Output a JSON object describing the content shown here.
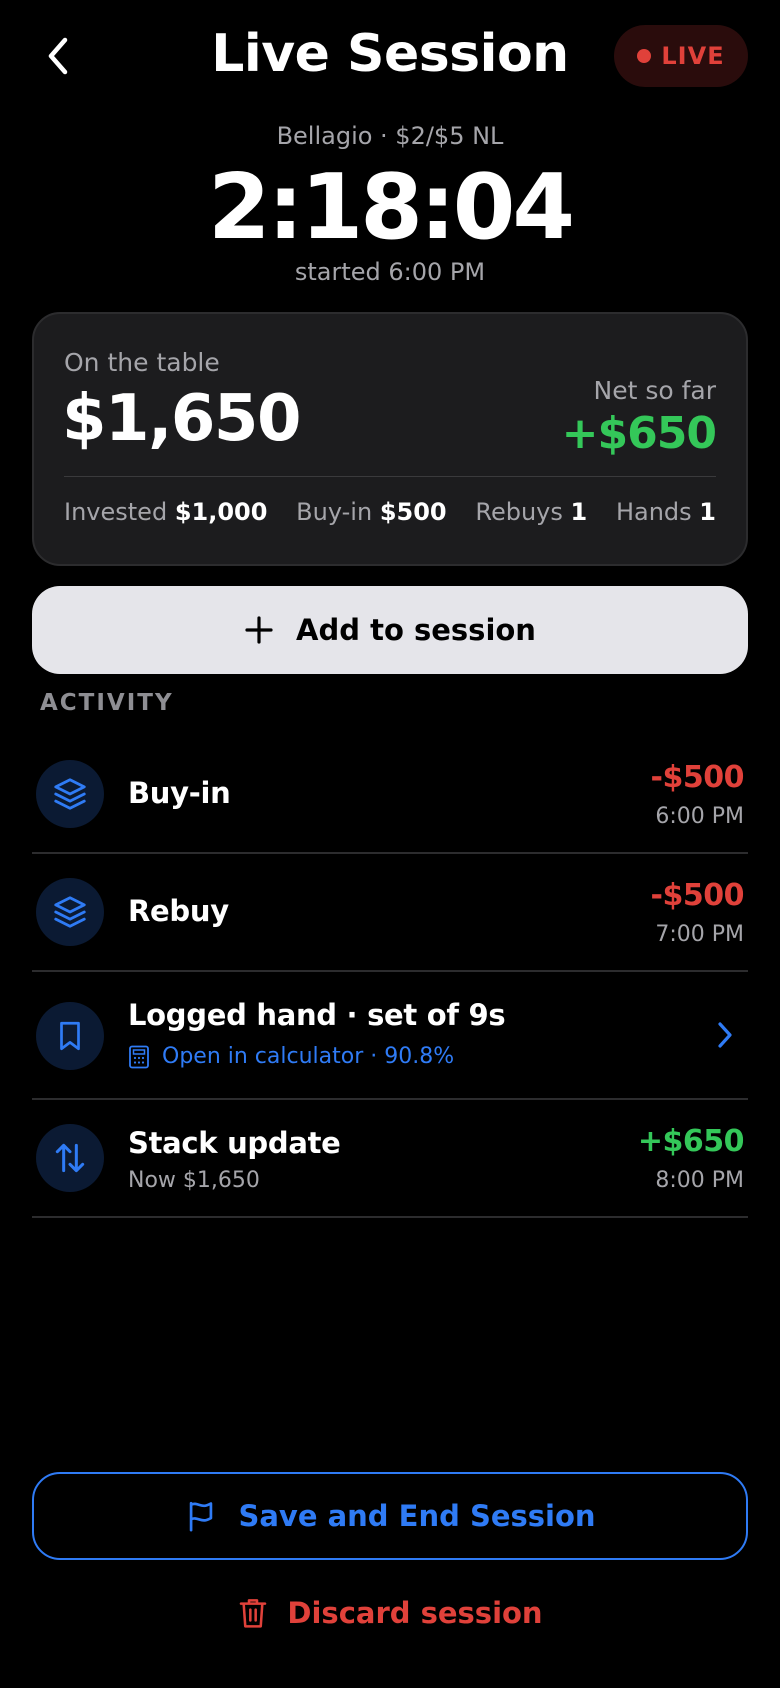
{
  "header": {
    "title": "Live Session",
    "live_label": "LIVE",
    "back_icon": "chevron-left-icon"
  },
  "session": {
    "venue": "Bellagio · $2/$5 NL",
    "timer": "2:18:04",
    "started": "started 6:00 PM"
  },
  "summary": {
    "on_table_label": "On the table",
    "on_table_value": "$1,650",
    "net_label": "Net so far",
    "net_value": "+$650",
    "stats": [
      {
        "label": "Invested",
        "value": "$1,000"
      },
      {
        "label": "Buy-in",
        "value": "$500"
      },
      {
        "label": "Rebuys",
        "value": "1"
      },
      {
        "label": "Hands",
        "value": "1"
      }
    ]
  },
  "add_button": {
    "label": "Add to session",
    "icon": "plus-icon"
  },
  "activity": {
    "heading": "ACTIVITY",
    "items": [
      {
        "title": "Buy-in",
        "amount": "-$500",
        "time": "6:00 PM",
        "icon": "layers-icon"
      },
      {
        "title": "Rebuy",
        "amount": "-$500",
        "time": "7:00 PM",
        "icon": "layers-icon"
      },
      {
        "title": "Logged hand · set of 9s",
        "link": "Open in calculator · 90.8%",
        "icon": "bookmark-icon",
        "link_icon": "calculator-icon"
      },
      {
        "title": "Stack update",
        "subtitle": "Now $1,650",
        "amount": "+$650",
        "time": "8:00 PM",
        "icon": "swap-vertical-icon"
      }
    ]
  },
  "footer": {
    "save_label": "Save and End Session",
    "save_icon": "flag-icon",
    "discard_label": "Discard session",
    "discard_icon": "trash-icon"
  },
  "colors": {
    "accent_blue": "#2f7bf5",
    "danger_red": "#e0413a",
    "success_green": "#34c759",
    "card_bg": "#1c1c1e"
  }
}
